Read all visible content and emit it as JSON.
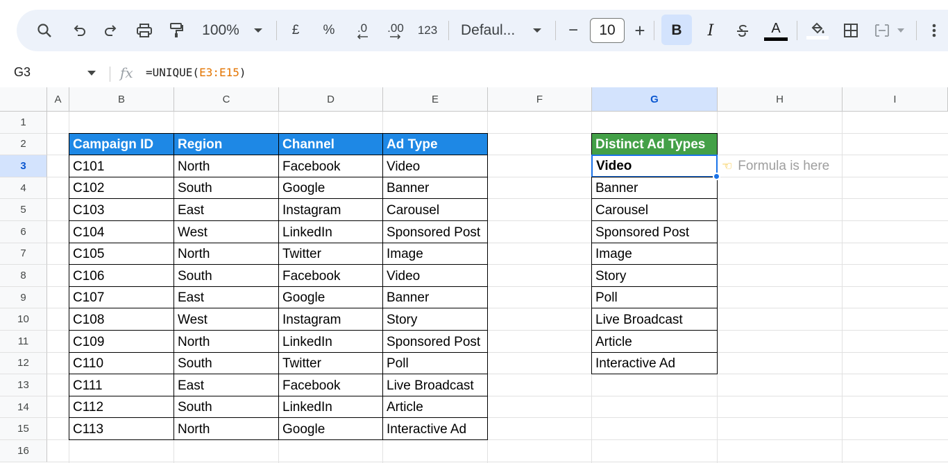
{
  "toolbar": {
    "zoom": "100%",
    "currency": "£",
    "percent": "%",
    "decrease_decimal": ".0",
    "increase_decimal": ".00",
    "number_format": "123",
    "font": "Defaul...",
    "font_size": "10",
    "minus": "−",
    "plus": "+",
    "bold": "B",
    "italic": "I",
    "text_color_letter": "A",
    "colors": {
      "toolbar_bg": "#edf2fa",
      "bold_active_bg": "#d3e3fd"
    }
  },
  "formula_bar": {
    "name_box": "G3",
    "fx": "fx",
    "formula_prefix": "=UNIQUE(",
    "formula_range": "E3:E15",
    "formula_suffix": ")"
  },
  "columns": [
    "A",
    "B",
    "C",
    "D",
    "E",
    "F",
    "G",
    "H",
    "I"
  ],
  "rows": [
    "1",
    "2",
    "3",
    "4",
    "5",
    "6",
    "7",
    "8",
    "9",
    "10",
    "11",
    "12",
    "13",
    "14",
    "15",
    "16"
  ],
  "selected_cell": {
    "column": "G",
    "row": "3"
  },
  "source_table": {
    "headers": [
      "Campaign ID",
      "Region",
      "Channel",
      "Ad Type"
    ],
    "rows": [
      [
        "C101",
        "North",
        "Facebook",
        "Video"
      ],
      [
        "C102",
        "South",
        "Google",
        "Banner"
      ],
      [
        "C103",
        "East",
        "Instagram",
        "Carousel"
      ],
      [
        "C104",
        "West",
        "LinkedIn",
        "Sponsored Post"
      ],
      [
        "C105",
        "North",
        "Twitter",
        "Image"
      ],
      [
        "C106",
        "South",
        "Facebook",
        "Video"
      ],
      [
        "C107",
        "East",
        "Google",
        "Banner"
      ],
      [
        "C108",
        "West",
        "Instagram",
        "Story"
      ],
      [
        "C109",
        "North",
        "LinkedIn",
        "Sponsored Post"
      ],
      [
        "C110",
        "South",
        "Twitter",
        "Poll"
      ],
      [
        "C111",
        "East",
        "Facebook",
        "Live Broadcast"
      ],
      [
        "C112",
        "South",
        "LinkedIn",
        "Article"
      ],
      [
        "C113",
        "North",
        "Google",
        "Interactive Ad"
      ]
    ],
    "header_color": "#1e88e5"
  },
  "result_table": {
    "header": "Distinct Ad Types",
    "values": [
      "Video",
      "Banner",
      "Carousel",
      "Sponsored Post",
      "Image",
      "Story",
      "Poll",
      "Live Broadcast",
      "Article",
      "Interactive Ad"
    ],
    "header_color": "#43a047"
  },
  "note": {
    "icon": "pointing-hand-icon",
    "text": "Formula is here"
  }
}
